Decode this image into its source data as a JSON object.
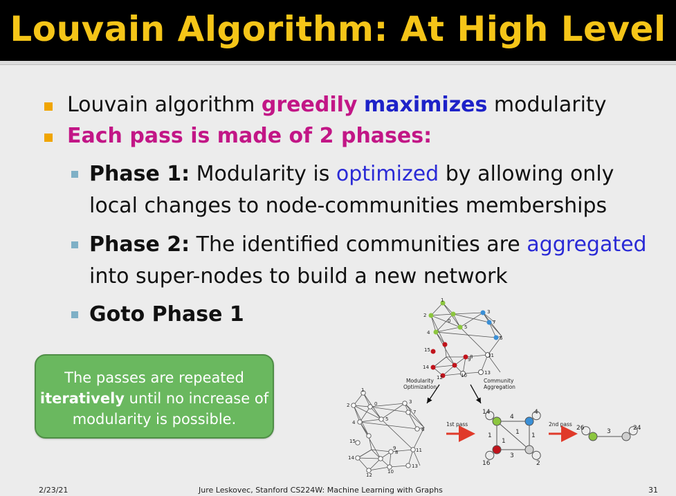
{
  "title": "Louvain Algorithm: At High Level",
  "bullet1": {
    "part1": "Louvain algorithm ",
    "greedily": "greedily",
    "maximizes": "maximizes",
    "part2": " modularity"
  },
  "bullet2": "Each pass is made of 2 phases:",
  "phase1": {
    "label": "Phase 1:",
    "text_a": " Modularity is ",
    "optimized": "optimized",
    "text_b": " by allowing only",
    "line2": "local changes to node-communities memberships"
  },
  "phase2": {
    "label": "Phase 2:",
    "text_a": " The identified communities are ",
    "aggregated": "aggregated",
    "line2": "into super-nodes to build a new network"
  },
  "goto": "Goto Phase 1",
  "callout": {
    "line1": "The passes are repeated",
    "iteratively": "iteratively",
    "line2_rest": " until no increase of",
    "line3": "modularity is possible."
  },
  "figure": {
    "modularity_optimization": [
      "Modularity",
      "Optimization"
    ],
    "community_aggregation": [
      "Community",
      "Aggregation"
    ],
    "first_pass": "1st pass",
    "second_pass": "2nd pass",
    "top_labels": [
      "1",
      "2",
      "3",
      "4",
      "5",
      "6",
      "7",
      "8",
      "9",
      "10",
      "11",
      "12",
      "13",
      "14",
      "15",
      "0"
    ],
    "left_labels": [
      "1",
      "2",
      "3",
      "4",
      "5",
      "6",
      "7",
      "8",
      "9",
      "10",
      "11",
      "12",
      "13",
      "14",
      "15",
      "0"
    ],
    "agg_node_labels": [
      "14",
      "4",
      "16",
      "2"
    ],
    "agg_edge_labels": [
      "4",
      "1",
      "1",
      "1",
      "3",
      "1"
    ],
    "final_node_labels": [
      "26",
      "24"
    ],
    "final_edge_label": "3"
  },
  "footer": {
    "date": "2/23/21",
    "credit": "Jure Leskovec, Stanford CS224W: Machine Learning with Graphs",
    "page": "31"
  },
  "colors": {
    "title": "#f5c518",
    "magenta": "#c21686",
    "blue": "#1d22c8",
    "callout": "#6ab85f",
    "node_green": "#8cc63f",
    "node_blue": "#3a8fd6",
    "node_red": "#c0141c",
    "node_gray": "#cfcfcf",
    "arrow_red": "#e03a2a"
  }
}
